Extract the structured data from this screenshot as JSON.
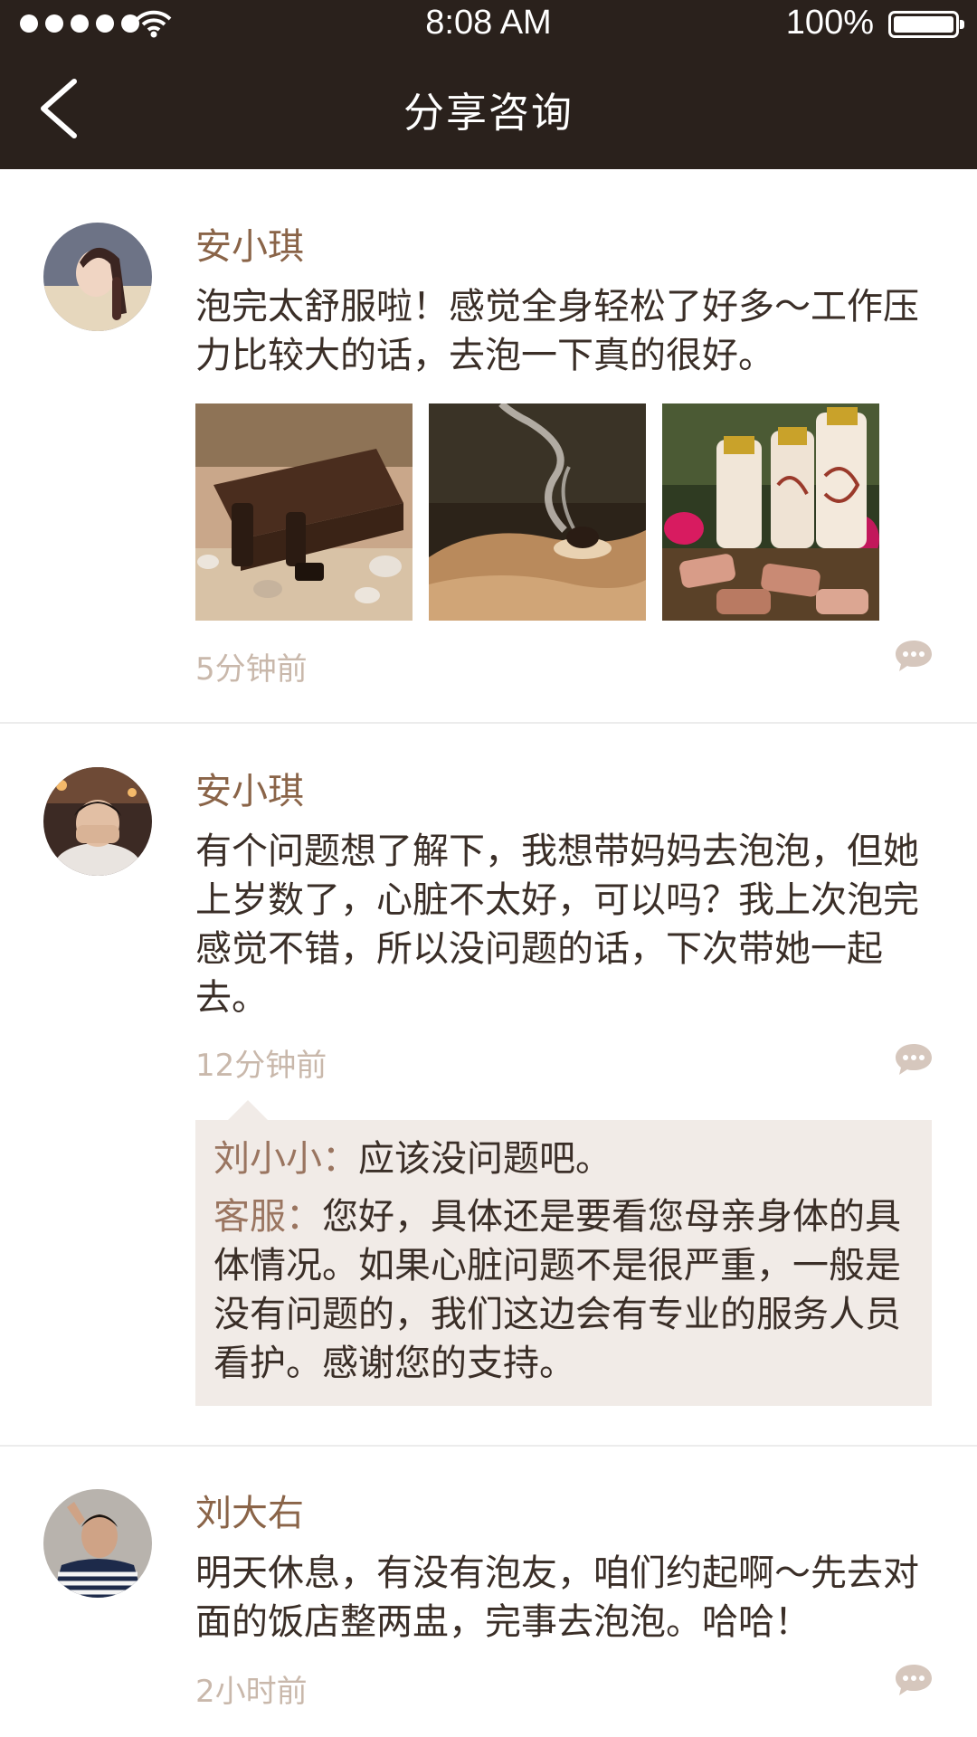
{
  "status_bar": {
    "time": "8:08 AM",
    "battery": "100%"
  },
  "header": {
    "title": "分享咨询"
  },
  "posts": [
    {
      "name": "安小琪",
      "text": "泡完太舒服啦！感觉全身轻松了好多～工作压力比较大的话，去泡一下真的很好。",
      "time": "5分钟前"
    },
    {
      "name": "安小琪",
      "text": "有个问题想了解下，我想带妈妈去泡泡，但她上岁数了，心脏不太好，可以吗？我上次泡完感觉不错，所以没问题的话，下次带她一起去。",
      "time": "12分钟前",
      "replies": [
        {
          "who": "刘小小：",
          "text": "应该没问题吧。"
        },
        {
          "who": "客服：",
          "text": "您好，具体还是要看您母亲身体的具体情况。如果心脏问题不是很严重，一般是没有问题的，我们这边会有专业的服务人员看护。感谢您的支持。"
        }
      ]
    },
    {
      "name": "刘大右",
      "text": "明天休息，有没有泡友，咱们约起啊～先去对面的饭店整两盅，完事去泡泡。哈哈！",
      "time": "2小时前"
    }
  ],
  "colors": {
    "header_bg": "#2a211c",
    "name": "#8a6448",
    "time": "#c9b8ab",
    "reply_bg": "#f1ebe7"
  }
}
